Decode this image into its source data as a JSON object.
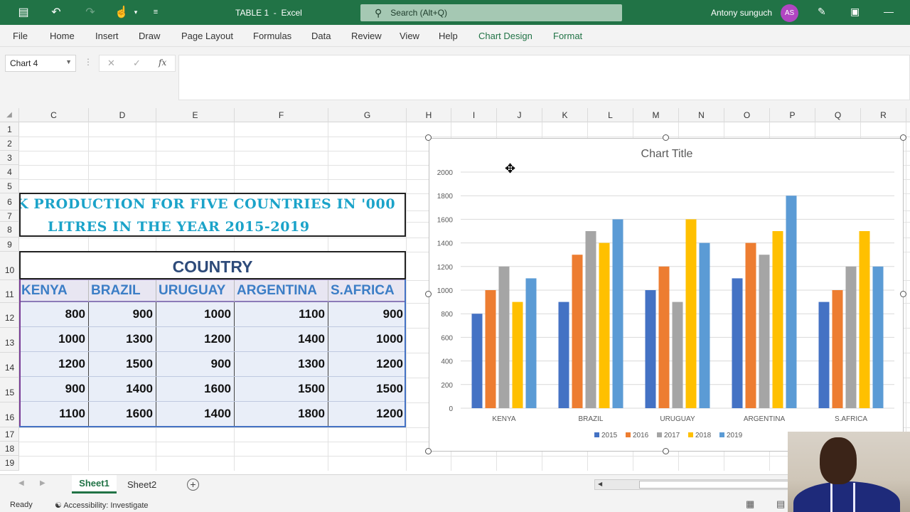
{
  "titlebar": {
    "doc_title": "TABLE 1  -  Excel",
    "search_placeholder": "Search (Alt+Q)",
    "user_name": "Antony sunguch",
    "user_initials": "AS"
  },
  "ribbon": {
    "tabs": [
      "File",
      "Home",
      "Insert",
      "Draw",
      "Page Layout",
      "Formulas",
      "Data",
      "Review",
      "View",
      "Help",
      "Chart Design",
      "Format"
    ]
  },
  "formula_bar": {
    "name_box": "Chart 4",
    "cancel_glyph": "✕",
    "enter_glyph": "✓",
    "fx_label": "fx",
    "formula": ""
  },
  "columns": [
    "C",
    "D",
    "E",
    "F",
    "G",
    "H",
    "I",
    "J",
    "K",
    "L",
    "M",
    "N",
    "O",
    "P",
    "Q",
    "R"
  ],
  "rows": [
    "1",
    "2",
    "3",
    "4",
    "5",
    "6",
    "7",
    "8",
    "9",
    "10",
    "11",
    "12",
    "13",
    "14",
    "15",
    "16",
    "17",
    "18",
    "19"
  ],
  "table": {
    "title_line1": "K PRODUCTION FOR FIVE COUNTRIES IN '000",
    "title_line2": "LITRES IN THE YEAR 2015-2019",
    "header": "COUNTRY",
    "countries": [
      "KENYA",
      "BRAZIL",
      "URUGUAY",
      "ARGENTINA",
      "S.AFRICA"
    ],
    "rows": [
      [
        "800",
        "900",
        "1000",
        "1100",
        "900"
      ],
      [
        "1000",
        "1300",
        "1200",
        "1400",
        "1000"
      ],
      [
        "1200",
        "1500",
        "900",
        "1300",
        "1200"
      ],
      [
        "900",
        "1400",
        "1600",
        "1500",
        "1500"
      ],
      [
        "1100",
        "1600",
        "1400",
        "1800",
        "1200"
      ]
    ]
  },
  "chart_data": {
    "type": "bar",
    "title": "Chart Title",
    "categories": [
      "KENYA",
      "BRAZIL",
      "URUGUAY",
      "ARGENTINA",
      "S.AFRICA"
    ],
    "series": [
      {
        "name": "2015",
        "color": "#4472c4",
        "values": [
          800,
          900,
          1000,
          1100,
          900
        ]
      },
      {
        "name": "2016",
        "color": "#ed7d31",
        "values": [
          1000,
          1300,
          1200,
          1400,
          1000
        ]
      },
      {
        "name": "2017",
        "color": "#a5a5a5",
        "values": [
          1200,
          1500,
          900,
          1300,
          1200
        ]
      },
      {
        "name": "2018",
        "color": "#ffc000",
        "values": [
          900,
          1400,
          1600,
          1500,
          1500
        ]
      },
      {
        "name": "2019",
        "color": "#5b9bd5",
        "values": [
          1100,
          1600,
          1400,
          1800,
          1200
        ]
      }
    ],
    "ylim": [
      0,
      2000
    ],
    "yticks": [
      "0",
      "200",
      "400",
      "600",
      "800",
      "1000",
      "1200",
      "1400",
      "1600",
      "1800",
      "2000"
    ],
    "grid": true,
    "legend": "bottom"
  },
  "sheets": {
    "tabs": [
      "Sheet1",
      "Sheet2"
    ],
    "active": "Sheet1"
  },
  "status": {
    "ready": "Ready",
    "accessibility": "Accessibility: Investigate"
  }
}
